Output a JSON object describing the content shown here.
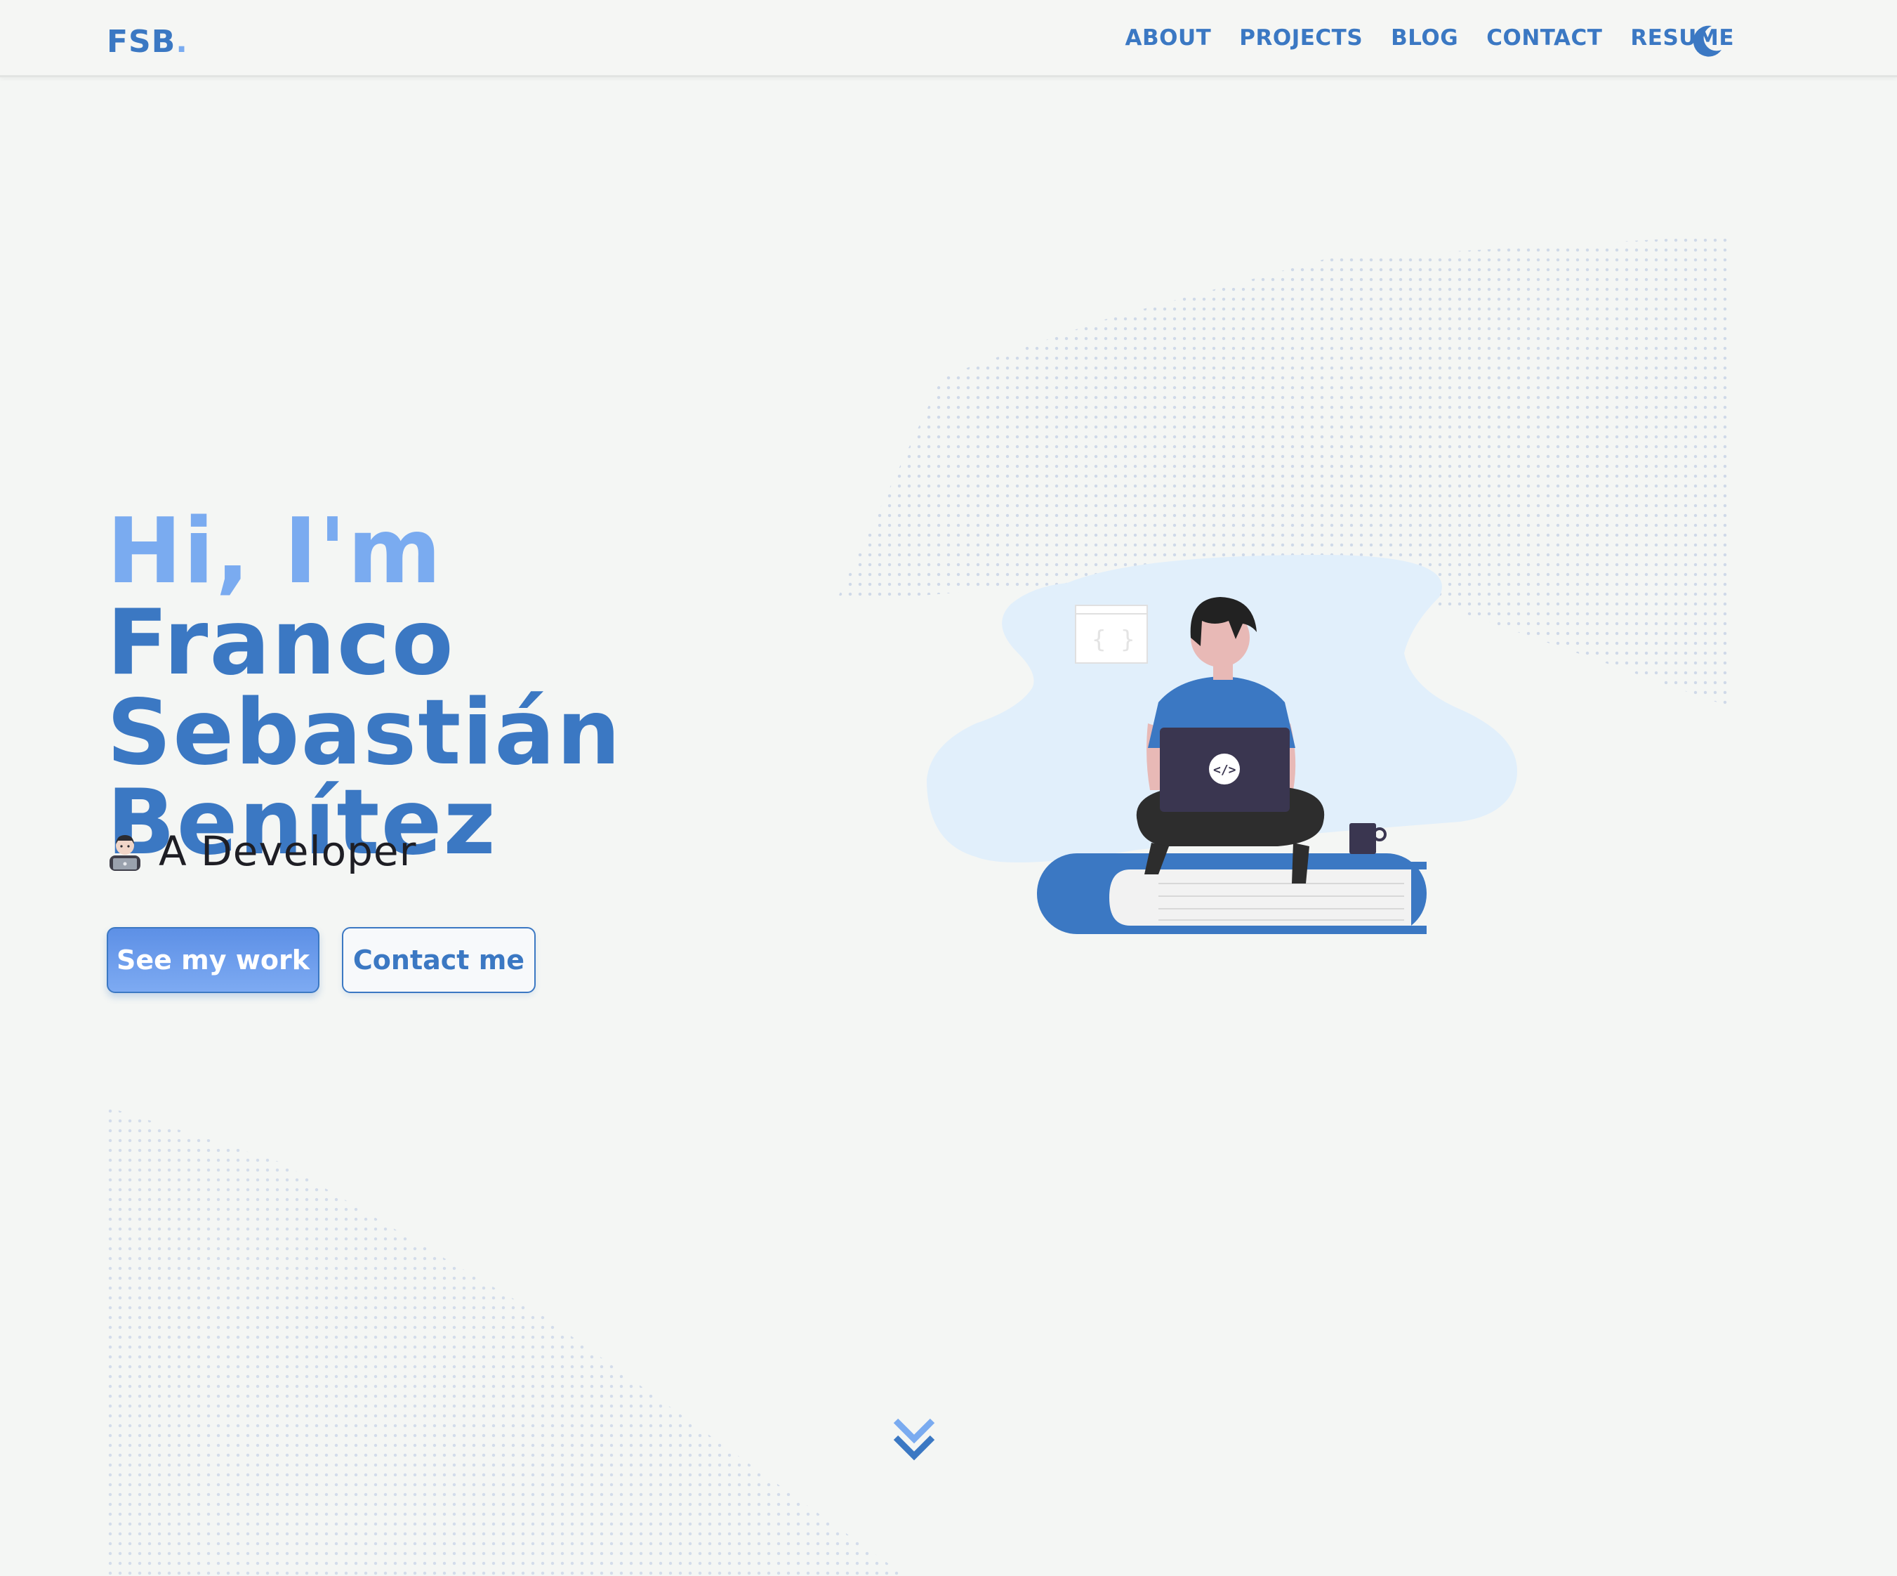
{
  "header": {
    "logo": "FSB",
    "logo_dot": ".",
    "nav": [
      "ABOUT",
      "PROJECTS",
      "BLOG",
      "CONTACT",
      "RESUME"
    ],
    "theme_toggle_icon": "moon-icon"
  },
  "hero": {
    "greeting": "Hi, I'm",
    "name_line1": "Franco Sebastián",
    "name_line2": "Benítez",
    "role_emoji": "man-technologist-icon",
    "role": "A Developer",
    "primary_button": "See my work",
    "secondary_button": "Contact me",
    "scroll_icon": "double-chevron-down-icon"
  },
  "colors": {
    "primary": "#3b78c3",
    "accent": "#7aabf0",
    "background": "#f4f6f4",
    "text": "#1e1e24"
  }
}
